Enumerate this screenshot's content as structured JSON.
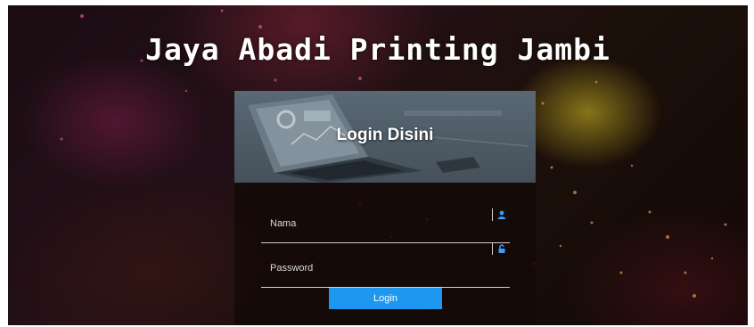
{
  "page": {
    "title": "Jaya Abadi Printing Jambi"
  },
  "login": {
    "heading": "Login Disini",
    "username_placeholder": "Nama",
    "password_placeholder": "Password",
    "submit_label": "Login"
  },
  "colors": {
    "accent": "#1e97f0",
    "card_bg": "rgba(18,8,6,0.72)",
    "title": "#ffffff"
  },
  "icons": {
    "username": "user-icon",
    "password": "lock-icon"
  }
}
